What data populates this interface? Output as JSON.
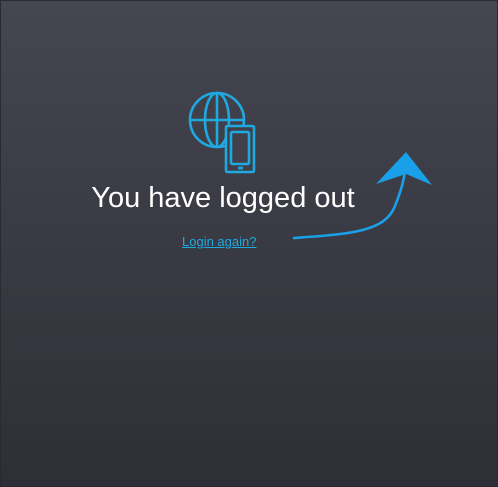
{
  "message": {
    "title": "You have logged out",
    "link_label": "Login again?"
  },
  "icons": {
    "main": "globe-phone-icon",
    "pointer": "arrow-annotation-icon"
  },
  "colors": {
    "background_top": "#454650",
    "background_bottom": "#2e2f36",
    "title": "#ffffff",
    "accent": "#1fa9e0",
    "arrow": "#19a0e8"
  }
}
